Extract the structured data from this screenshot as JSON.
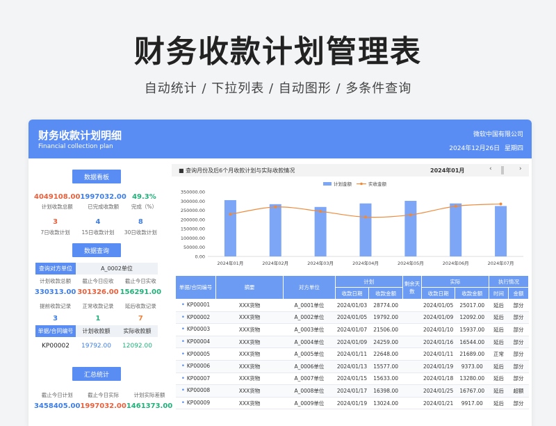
{
  "hero": {
    "title": "财务收款计划管理表",
    "subtitle": "自动统计 / 下拉列表 / 自动图形 / 多条件查询"
  },
  "header": {
    "title": "财务收款计划明细",
    "subtitle_en": "Financial collection plan",
    "company": "微软中国有限公司",
    "date": "2024年12月26日",
    "weekday": "星期四"
  },
  "colors": {
    "accent": "#5a8df3",
    "bar": "#7ea6f6",
    "line": "#ee8a3a",
    "red": "#e8603c",
    "green": "#21b07a"
  },
  "dashboard": {
    "label": "数据看板",
    "kpis": [
      {
        "value": "4049108.00",
        "label": "计划收款总额"
      },
      {
        "value": "1997032.00",
        "label": "已完成收款额"
      },
      {
        "value": "49.3%",
        "label": "完成（%）"
      }
    ],
    "counts": [
      {
        "value": "3",
        "label": "7日收款计划"
      },
      {
        "value": "4",
        "label": "15日收款计划"
      },
      {
        "value": "8",
        "label": "30日收款计划"
      }
    ]
  },
  "query": {
    "label": "数据查询",
    "counterpart_label": "查询对方单位",
    "counterpart_value": "A_0002单位",
    "amounts": [
      {
        "label": "计划收款总额",
        "value": "330313.00"
      },
      {
        "label": "截止今日应收",
        "value": "301326.00"
      },
      {
        "label": "截止今日实收",
        "value": "156291.00"
      }
    ],
    "records": [
      {
        "label": "提前收款记录",
        "value": "3"
      },
      {
        "label": "正常收款记录",
        "value": "1"
      },
      {
        "label": "延后收款记录",
        "value": "7"
      }
    ],
    "order_header": [
      "单据/合同编号",
      "计划收款额",
      "实际收款额"
    ],
    "order_values": [
      "KP00002",
      "19792.00",
      "12092.00"
    ]
  },
  "summary": {
    "label": "汇总统计",
    "items": [
      {
        "label": "截止今日计划",
        "value": "3458405.00"
      },
      {
        "label": "截止今日实际",
        "value": "1997032.00"
      },
      {
        "label": "计划实际差额",
        "value": "1461373.00"
      }
    ]
  },
  "chart_head": {
    "title": "■ 查询月份及后6个月收款计划与实际收款情况",
    "month": "2024年01月",
    "prev": "‹",
    "next": "›"
  },
  "chart_data": {
    "type": "bar",
    "categories": [
      "2024年01月",
      "2024年02月",
      "2024年03月",
      "2024年04月",
      "2024年05月",
      "2024年06月",
      "2024年07月"
    ],
    "series": [
      {
        "name": "计划金额",
        "type": "bar",
        "values": [
          305000,
          283000,
          268000,
          287000,
          301000,
          287000,
          273000
        ]
      },
      {
        "name": "实收金额",
        "type": "line",
        "values": [
          228000,
          268000,
          244000,
          213000,
          225000,
          272000,
          284000
        ]
      }
    ],
    "yticks": [
      "0.00",
      "50000.00",
      "100000.00",
      "150000.00",
      "200000.00",
      "250000.00",
      "300000.00",
      "350000.00"
    ],
    "ylim": [
      0,
      350000
    ],
    "legend": "top-center"
  },
  "table": {
    "group_headers": [
      "单据/合同编号",
      "摘要",
      "对方单位",
      "计划",
      "剩余天数",
      "实际",
      "执行情况"
    ],
    "sub_headers": [
      "收款日期",
      "收款金额",
      "收款日期",
      "收款金额",
      "时间",
      "金额"
    ],
    "rows": [
      [
        "KP00001",
        "XXX货物",
        "A_0001单位",
        "2024/01/03",
        "28774.00",
        "",
        "2024/01/05",
        "25017.00",
        "延后",
        "部分"
      ],
      [
        "KP00002",
        "XXX货物",
        "A_0002单位",
        "2024/01/05",
        "19792.00",
        "",
        "2024/01/09",
        "12092.00",
        "延后",
        "部分"
      ],
      [
        "KP00003",
        "XXX货物",
        "A_0003单位",
        "2024/01/07",
        "21506.00",
        "",
        "2024/01/10",
        "15937.00",
        "延后",
        "部分"
      ],
      [
        "KP00004",
        "XXX货物",
        "A_0004单位",
        "2024/01/09",
        "24259.00",
        "",
        "2024/01/16",
        "16544.00",
        "延后",
        "部分"
      ],
      [
        "KP00005",
        "XXX货物",
        "A_0005单位",
        "2024/01/11",
        "22648.00",
        "",
        "2024/01/11",
        "21689.00",
        "正常",
        "部分"
      ],
      [
        "KP00006",
        "XXX货物",
        "A_0006单位",
        "2024/01/13",
        "15577.00",
        "",
        "2024/01/19",
        "9373.00",
        "延后",
        "部分"
      ],
      [
        "KP00007",
        "XXX货物",
        "A_0007单位",
        "2024/01/15",
        "15633.00",
        "",
        "2024/01/18",
        "13280.00",
        "延后",
        "部分"
      ],
      [
        "KP00008",
        "XXX货物",
        "A_0008单位",
        "2024/01/17",
        "16398.00",
        "",
        "2024/01/25",
        "16767.00",
        "延后",
        "超额"
      ],
      [
        "KP00009",
        "XXX货物",
        "A_0009单位",
        "2024/01/19",
        "13024.00",
        "",
        "2024/01/21",
        "9917.00",
        "延后",
        "部分"
      ]
    ]
  }
}
